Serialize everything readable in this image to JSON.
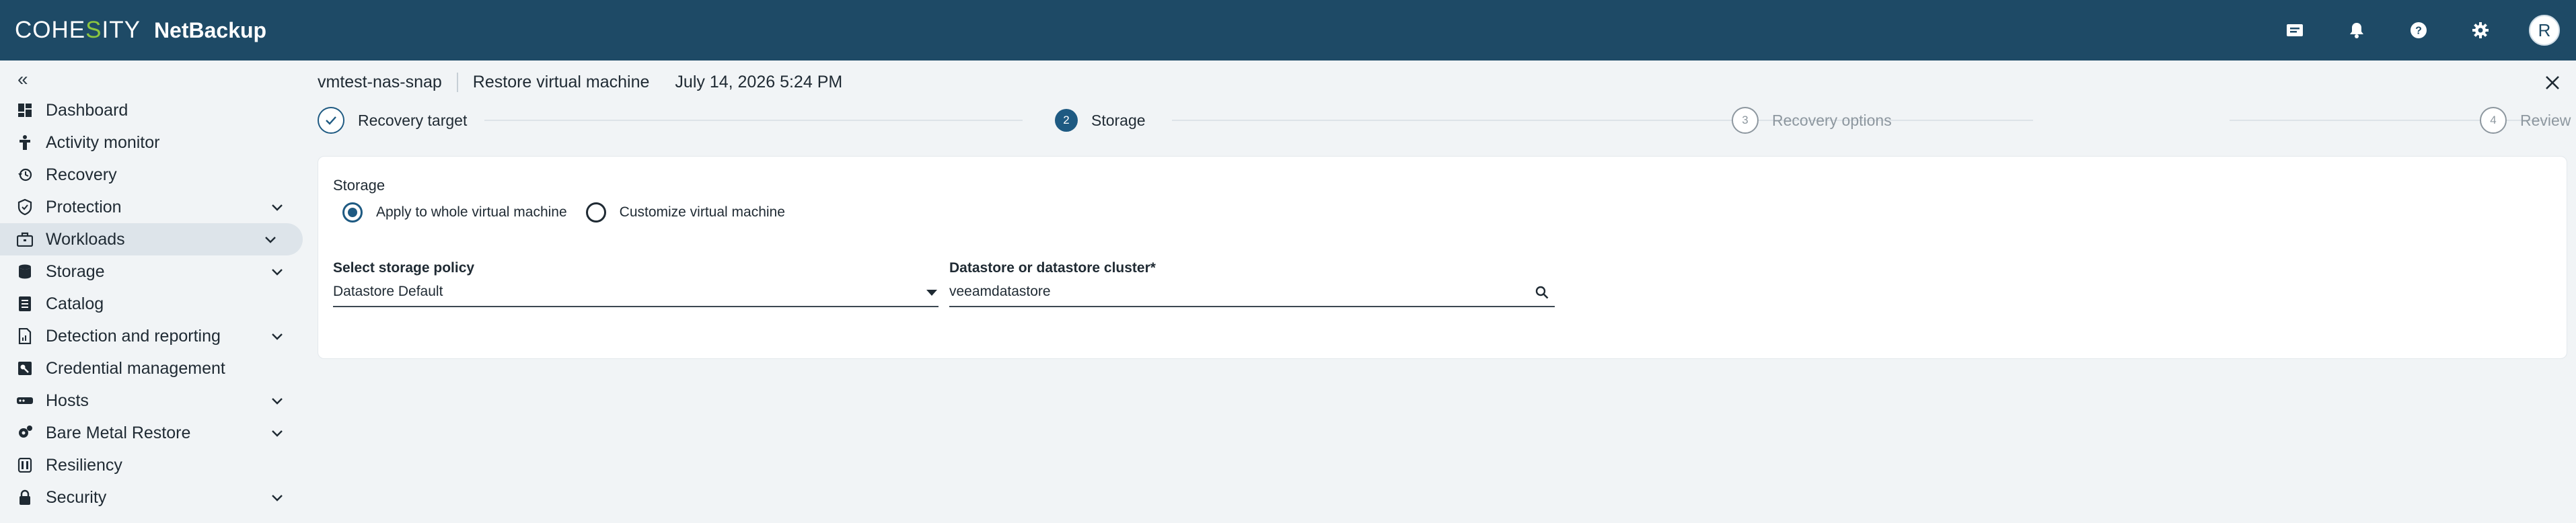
{
  "brand": {
    "logo_part1": "COHE",
    "logo_s": "S",
    "logo_part2": "ITY",
    "product": "NetBackup",
    "accent": "#8cc63f",
    "topbar_color": "#1e4a66"
  },
  "topbar": {
    "icons": [
      "announcements-icon",
      "notifications-bell-icon",
      "help-icon",
      "settings-gear-icon"
    ],
    "avatar_initial": "R"
  },
  "sidebar": {
    "collapse_glyph": "«",
    "items": [
      {
        "label": "Dashboard",
        "icon": "dashboard-icon",
        "expandable": false
      },
      {
        "label": "Activity monitor",
        "icon": "activity-monitor-icon",
        "expandable": false
      },
      {
        "label": "Recovery",
        "icon": "recovery-icon",
        "expandable": false
      },
      {
        "label": "Protection",
        "icon": "protection-shield-icon",
        "expandable": true
      },
      {
        "label": "Workloads",
        "icon": "workloads-briefcase-icon",
        "expandable": true,
        "active": true
      },
      {
        "label": "Storage",
        "icon": "storage-database-icon",
        "expandable": true
      },
      {
        "label": "Catalog",
        "icon": "catalog-icon",
        "expandable": false
      },
      {
        "label": "Detection and reporting",
        "icon": "report-icon",
        "expandable": true
      },
      {
        "label": "Credential management",
        "icon": "credential-key-icon",
        "expandable": false
      },
      {
        "label": "Hosts",
        "icon": "hosts-server-icon",
        "expandable": true
      },
      {
        "label": "Bare Metal Restore",
        "icon": "bare-metal-gear-icon",
        "expandable": true
      },
      {
        "label": "Resiliency",
        "icon": "resiliency-icon",
        "expandable": false
      },
      {
        "label": "Security",
        "icon": "security-lock-icon",
        "expandable": true
      }
    ]
  },
  "header": {
    "vm_name": "vmtest-nas-snap",
    "title": "Restore virtual machine",
    "date": "July 14, 2026 5:24 PM"
  },
  "stepper": {
    "steps": [
      {
        "number": "1",
        "label": "Recovery target",
        "state": "done"
      },
      {
        "number": "2",
        "label": "Storage",
        "state": "current"
      },
      {
        "number": "3",
        "label": "Recovery options",
        "state": "todo"
      },
      {
        "number": "4",
        "label": "Review",
        "state": "todo"
      }
    ]
  },
  "storage_form": {
    "section_label": "Storage",
    "radio_apply_whole": "Apply to whole virtual machine",
    "radio_customize": "Customize virtual machine",
    "selected_option": "Apply to whole virtual machine",
    "policy_label": "Select storage policy",
    "policy_value": "Datastore Default",
    "datastore_label": "Datastore or datastore cluster*",
    "datastore_value": "veeamdatastore"
  }
}
